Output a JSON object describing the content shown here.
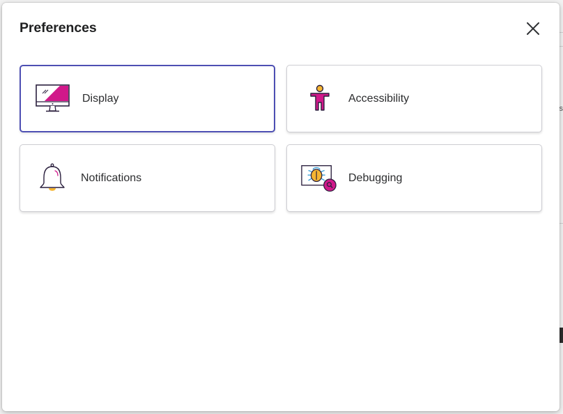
{
  "dialog": {
    "title": "Preferences",
    "close_icon": "close-icon"
  },
  "tiles": [
    {
      "label": "Display",
      "icon": "monitor-icon",
      "selected": true
    },
    {
      "label": "Accessibility",
      "icon": "accessibility-person-icon",
      "selected": false
    },
    {
      "label": "Notifications",
      "icon": "bell-icon",
      "selected": false
    },
    {
      "label": "Debugging",
      "icon": "bug-magnifier-icon",
      "selected": false
    }
  ],
  "colors": {
    "selected_border": "#4d4fb3",
    "accent_magenta": "#d1188a",
    "accent_yellow": "#f5b532",
    "accent_blue": "#3aa0d8"
  },
  "background": {
    "edge_char": "s"
  }
}
